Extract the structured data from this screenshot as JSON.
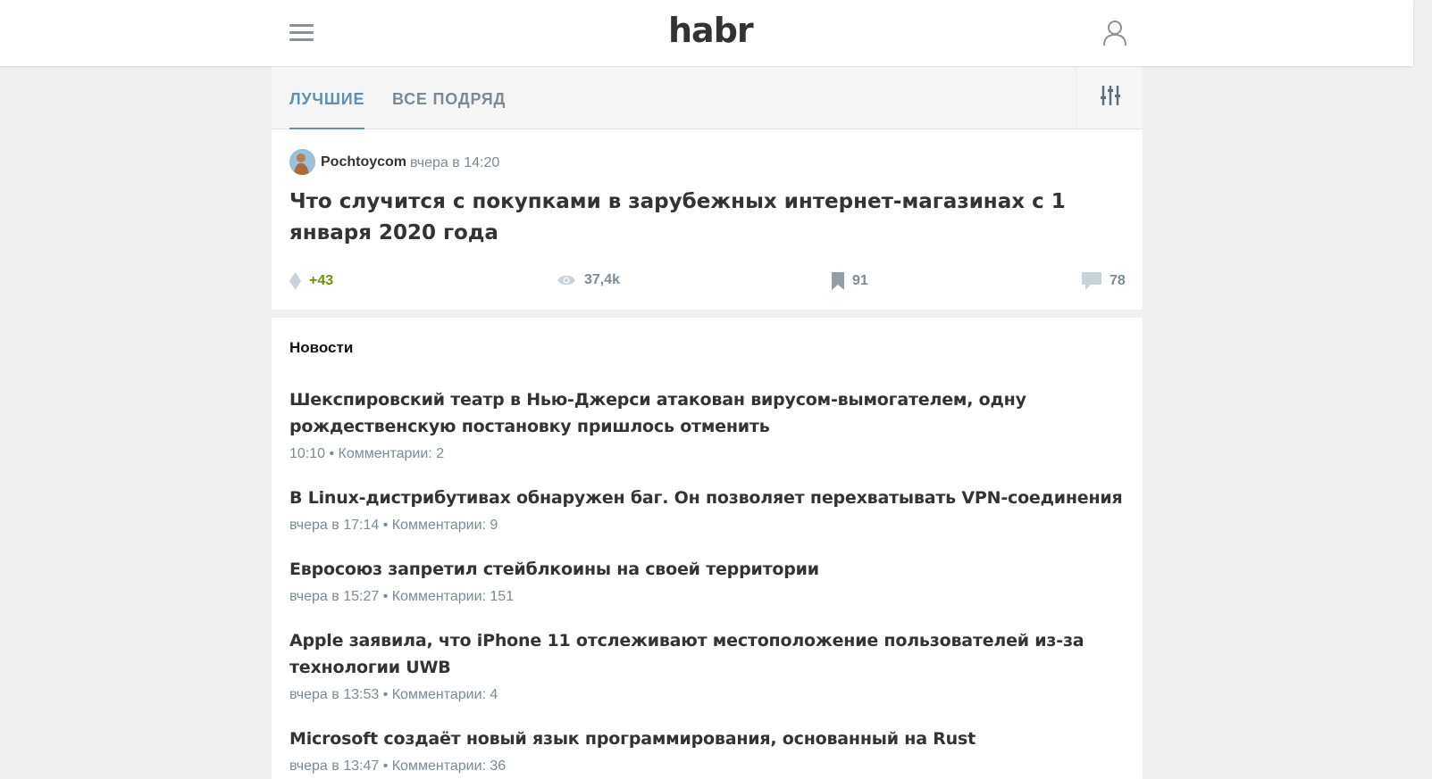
{
  "header": {
    "logo": "habr",
    "menu_icon": "hamburger-menu-icon",
    "user_icon": "user-profile-icon"
  },
  "tabs": [
    {
      "label": "Лучшие",
      "active": true
    },
    {
      "label": "Все подряд",
      "active": false
    }
  ],
  "filter_icon": "settings-sliders-icon",
  "featured_post": {
    "author": "Pochtoycom",
    "time": "вчера в 14:20",
    "title": "Что случится с покупками в зарубежных интернет-магазинах с 1 января 2020 года",
    "rating": "+43",
    "views": "37,4k",
    "bookmarks": "91",
    "comments": "78"
  },
  "news": {
    "heading": "Новости",
    "items": [
      {
        "title": "Шекспировский театр в Нью-Джерси атакован вирусом-вымогателем, одну рождественскую постановку пришлось отменить",
        "meta": "10:10 • Комментарии: 2"
      },
      {
        "title": "В Linux-дистрибутивах обнаружен баг. Он позволяет перехватывать VPN-соединения",
        "meta": "вчера в 17:14 • Комментарии: 9"
      },
      {
        "title": "Евросоюз запретил стейблкоины на своей территории",
        "meta": "вчера в 15:27 • Комментарии: 151"
      },
      {
        "title": "Apple заявила, что iPhone 11 отслеживают местоположение пользователей из-за технологии UWB",
        "meta": "вчера в 13:53 • Комментарии: 4"
      },
      {
        "title": "Microsoft создаёт новый язык программирования, основанный на Rust",
        "meta": "вчера в 13:47 • Комментарии: 36"
      }
    ]
  },
  "colors": {
    "accent": "#5e8fb5",
    "rating_positive": "#6c9007",
    "muted": "#7b8a94",
    "background": "#f0f0f0"
  }
}
